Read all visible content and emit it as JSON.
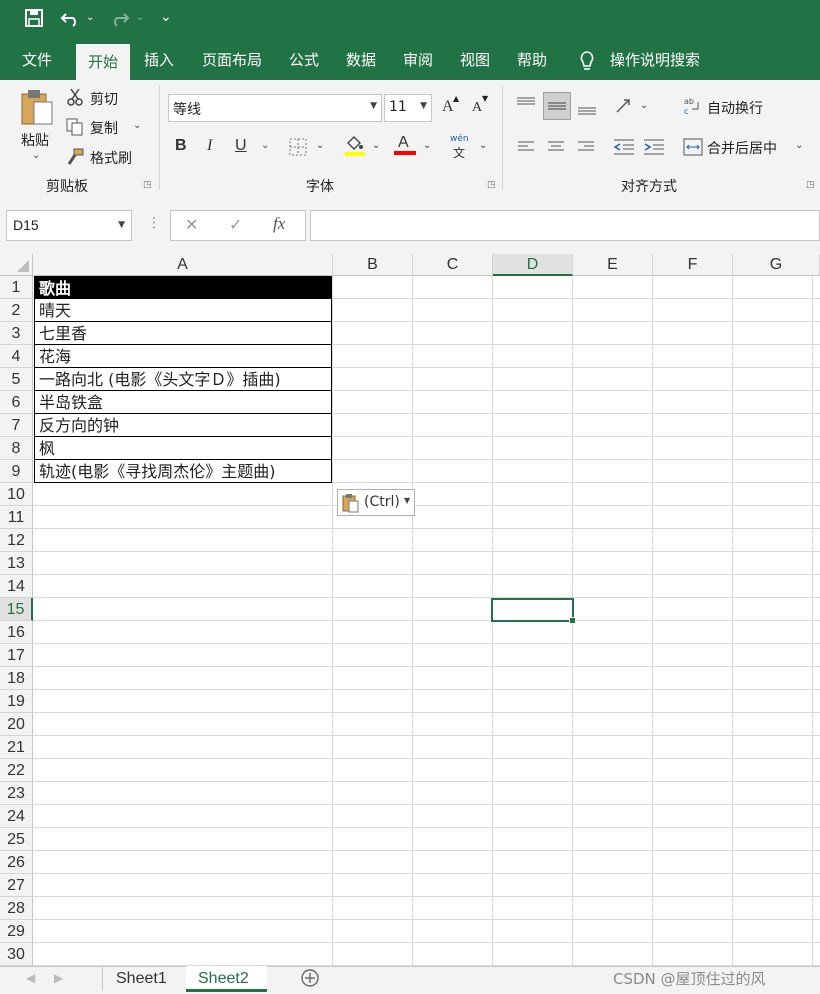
{
  "quick_access": {
    "save_icon": "save-icon",
    "undo_icon": "undo-icon",
    "redo_icon": "redo-icon",
    "customize_icon": "customize-icon"
  },
  "tabs": [
    "文件",
    "开始",
    "插入",
    "页面布局",
    "公式",
    "数据",
    "审阅",
    "视图",
    "帮助"
  ],
  "active_tab": "开始",
  "tell_me": "操作说明搜索",
  "clipboard": {
    "paste": "粘贴",
    "cut": "剪切",
    "copy": "复制",
    "format_painter": "格式刷",
    "group": "剪贴板"
  },
  "font": {
    "name": "等线",
    "size": "11",
    "group": "字体",
    "bold": "B",
    "italic": "I",
    "underline": "U",
    "grow": "A",
    "shrink": "A",
    "font_color_letter": "A",
    "phonetic_top": "wén",
    "phonetic_bottom": "文"
  },
  "alignment": {
    "wrap_text": "自动换行",
    "merge_center": "合并后居中",
    "group": "对齐方式"
  },
  "formula_bar": {
    "name_box": "D15",
    "cancel": "✕",
    "enter": "✓",
    "fx": "fx",
    "formula": ""
  },
  "columns": [
    "A",
    "B",
    "C",
    "D",
    "E",
    "F",
    "G"
  ],
  "selected_column": "D",
  "selected_row": "15",
  "rows": [
    "1",
    "2",
    "3",
    "4",
    "5",
    "6",
    "7",
    "8",
    "9",
    "10",
    "11",
    "12",
    "13",
    "14",
    "15",
    "16",
    "17",
    "18",
    "19",
    "20",
    "21",
    "22",
    "23",
    "24",
    "25",
    "26",
    "27",
    "28",
    "29",
    "30"
  ],
  "cells_a": [
    "歌曲",
    "晴天",
    "七里香",
    "花海",
    "一路向北 (电影《头文字Ｄ》插曲)",
    "半岛铁盒",
    "反方向的钟",
    "枫",
    "轨迹(电影《寻找周杰伦》主题曲)"
  ],
  "paste_options": "(Ctrl)",
  "sheets": [
    "Sheet1",
    "Sheet2"
  ],
  "active_sheet": "Sheet2",
  "watermark": "CSDN @屋顶住过的风",
  "colors": {
    "accent": "#217346",
    "header_fill": "#000000",
    "header_text": "#ffffff",
    "highlight": "#ffff00",
    "font_red": "#ff0000"
  }
}
